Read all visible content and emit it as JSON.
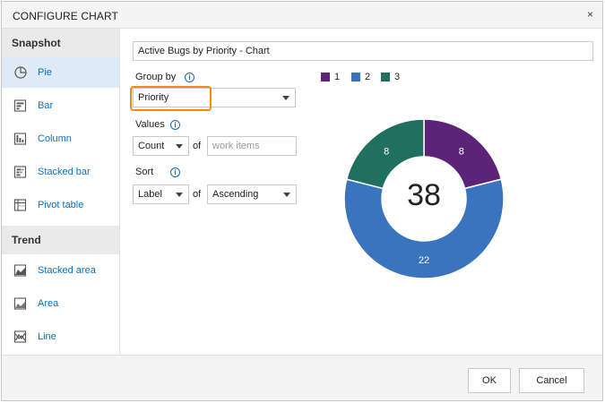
{
  "dialog": {
    "title": "CONFIGURE CHART",
    "close_glyph": "×"
  },
  "sidebar": {
    "snapshot_heading": "Snapshot",
    "trend_heading": "Trend",
    "snapshot_items": [
      {
        "label": "Pie",
        "icon": "pie-chart-icon",
        "selected": true
      },
      {
        "label": "Bar",
        "icon": "bar-chart-icon"
      },
      {
        "label": "Column",
        "icon": "column-chart-icon"
      },
      {
        "label": "Stacked bar",
        "icon": "stacked-bar-icon"
      },
      {
        "label": "Pivot table",
        "icon": "pivot-table-icon"
      }
    ],
    "trend_items": [
      {
        "label": "Stacked area",
        "icon": "stacked-area-icon"
      },
      {
        "label": "Area",
        "icon": "area-chart-icon"
      },
      {
        "label": "Line",
        "icon": "line-chart-icon"
      }
    ]
  },
  "config": {
    "chart_name": "Active Bugs by Priority - Chart",
    "group_by_label": "Group by",
    "group_by_value": "Priority",
    "values_label": "Values",
    "values_aggregate": "Count",
    "of_text": "of",
    "values_field_placeholder": "work items",
    "sort_label": "Sort",
    "sort_by": "Label",
    "sort_order": "Ascending",
    "info_glyph": "i"
  },
  "colors": {
    "accent": "#0a6fc2",
    "highlight": "#f28c10"
  },
  "chart_data": {
    "type": "pie",
    "style": "donut",
    "total": "38",
    "categories": [
      "1",
      "2",
      "3"
    ],
    "values": [
      8,
      22,
      8
    ],
    "colors": [
      "#5c2478",
      "#3a74be",
      "#1f7061"
    ]
  },
  "footer": {
    "ok_label": "OK",
    "cancel_label": "Cancel"
  }
}
